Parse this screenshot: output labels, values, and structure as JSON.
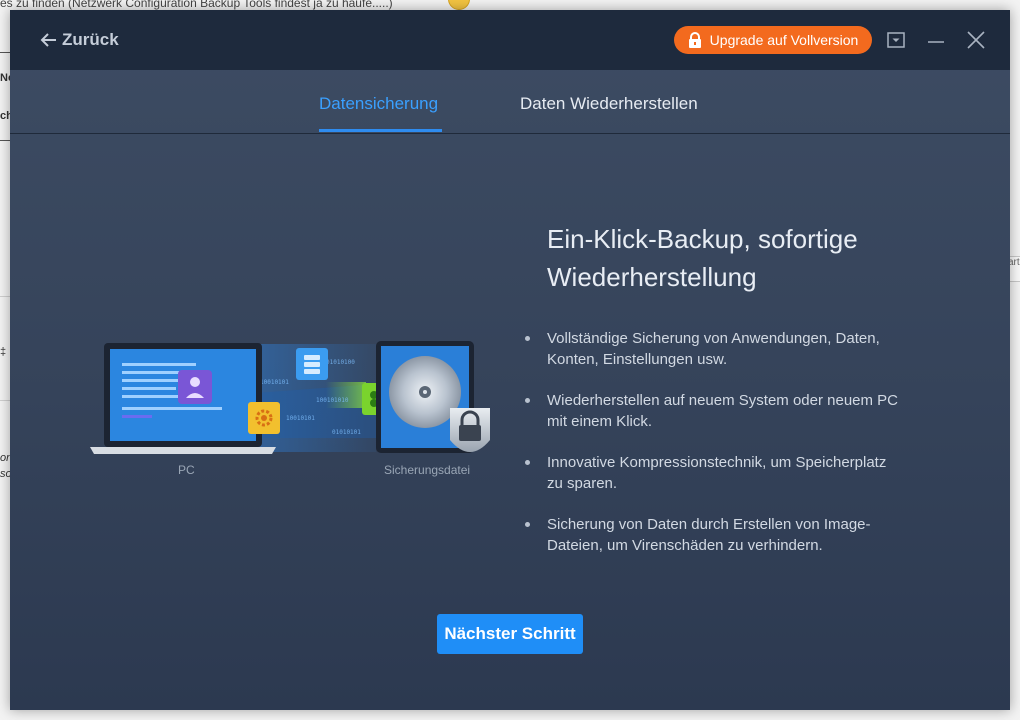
{
  "background": {
    "top_text": "es zu finden (Netzwerk Configuration Backup Tools findest ja zu haufe.....)",
    "fragments": [
      "No",
      "ch",
      "‡",
      "on",
      "so"
    ],
    "right_fragment": "art"
  },
  "titlebar": {
    "back_label": "Zurück",
    "upgrade_label": "Upgrade auf Vollversion",
    "icons": [
      "arrow-left-icon",
      "lock-icon",
      "menu-dropdown-icon",
      "minimize-icon",
      "close-icon"
    ]
  },
  "tabs": [
    {
      "label": "Datensicherung",
      "active": true
    },
    {
      "label": "Daten Wiederherstellen",
      "active": false
    }
  ],
  "illustration": {
    "pc_caption": "PC",
    "backup_caption": "Sicherungsdatei",
    "binary": [
      "01010100",
      "10010101",
      "100101010",
      "10010101",
      "01010101"
    ]
  },
  "content": {
    "headline": "Ein-Klick-Backup, sofortige Wiederherstellung",
    "features": [
      "Vollständige Sicherung von Anwendungen, Daten, Konten, Einstellungen usw.",
      "Wiederherstellen auf neuem System oder neuem PC mit einem Klick.",
      "Innovative Kompressionstechnik, um Speicherplatz zu sparen.",
      "Sicherung von Daten durch Erstellen von Image-Dateien, um Virenschäden zu verhindern."
    ]
  },
  "next_label": "Nächster Schritt",
  "colors": {
    "accent": "#1f8ef7",
    "tab_active": "#3aa0ff",
    "upgrade": "#f36a1e",
    "titlebar": "#1e2a3d",
    "panel": "#3d4c63"
  }
}
